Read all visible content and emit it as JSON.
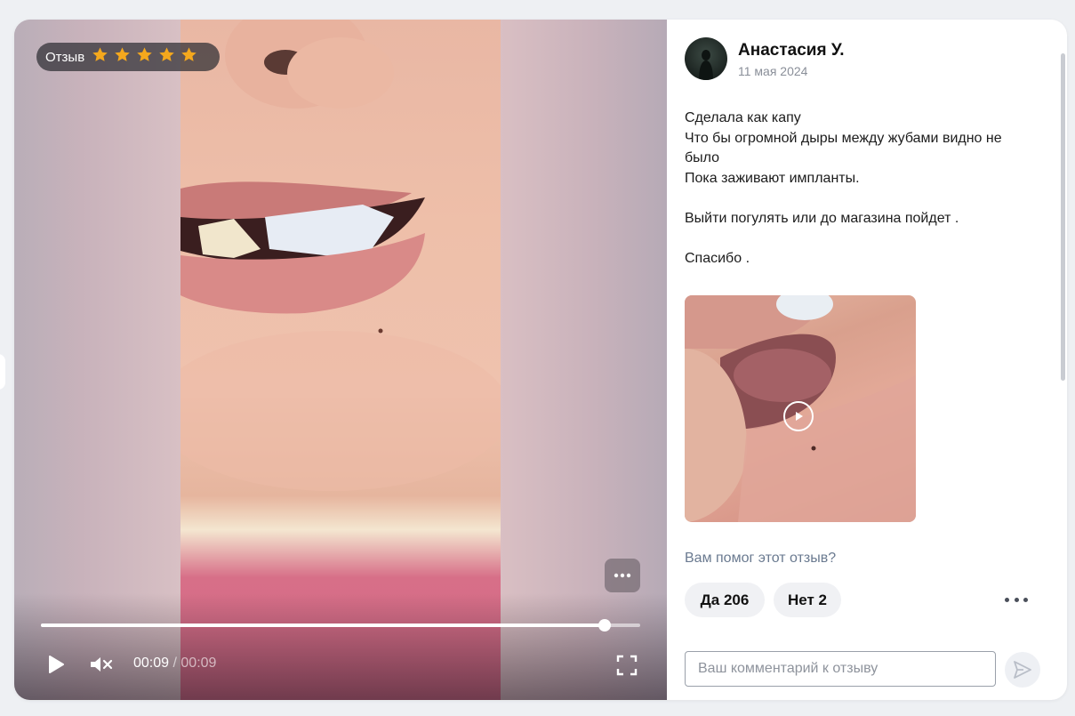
{
  "video": {
    "rating_label": "Отзыв",
    "stars": 5,
    "star_color": "#f4a81d",
    "current_time": "00:09",
    "time_separator": " / ",
    "duration": "00:09",
    "progress": 0.94,
    "icons": [
      "play-icon",
      "mute-icon",
      "fullscreen-icon",
      "more-icon"
    ]
  },
  "review": {
    "author": "Анастасия У.",
    "date": "11 мая 2024",
    "lines": [
      "Сделала как капу",
      "Что бы огромной дыры между жубами видно не было",
      "Пока заживают импланты.",
      "",
      "Выйти погулять или до магазина пойдет .",
      "",
      "Спасибо ."
    ]
  },
  "helpful": {
    "question": "Вам помог этот отзыв?",
    "yes_label": "Да 206",
    "no_label": "Нет 2"
  },
  "comment": {
    "placeholder": "Ваш комментарий к отзыву"
  },
  "colors": {
    "accent_text": "#6a7a90",
    "vote_bg": "#f0f1f4"
  }
}
